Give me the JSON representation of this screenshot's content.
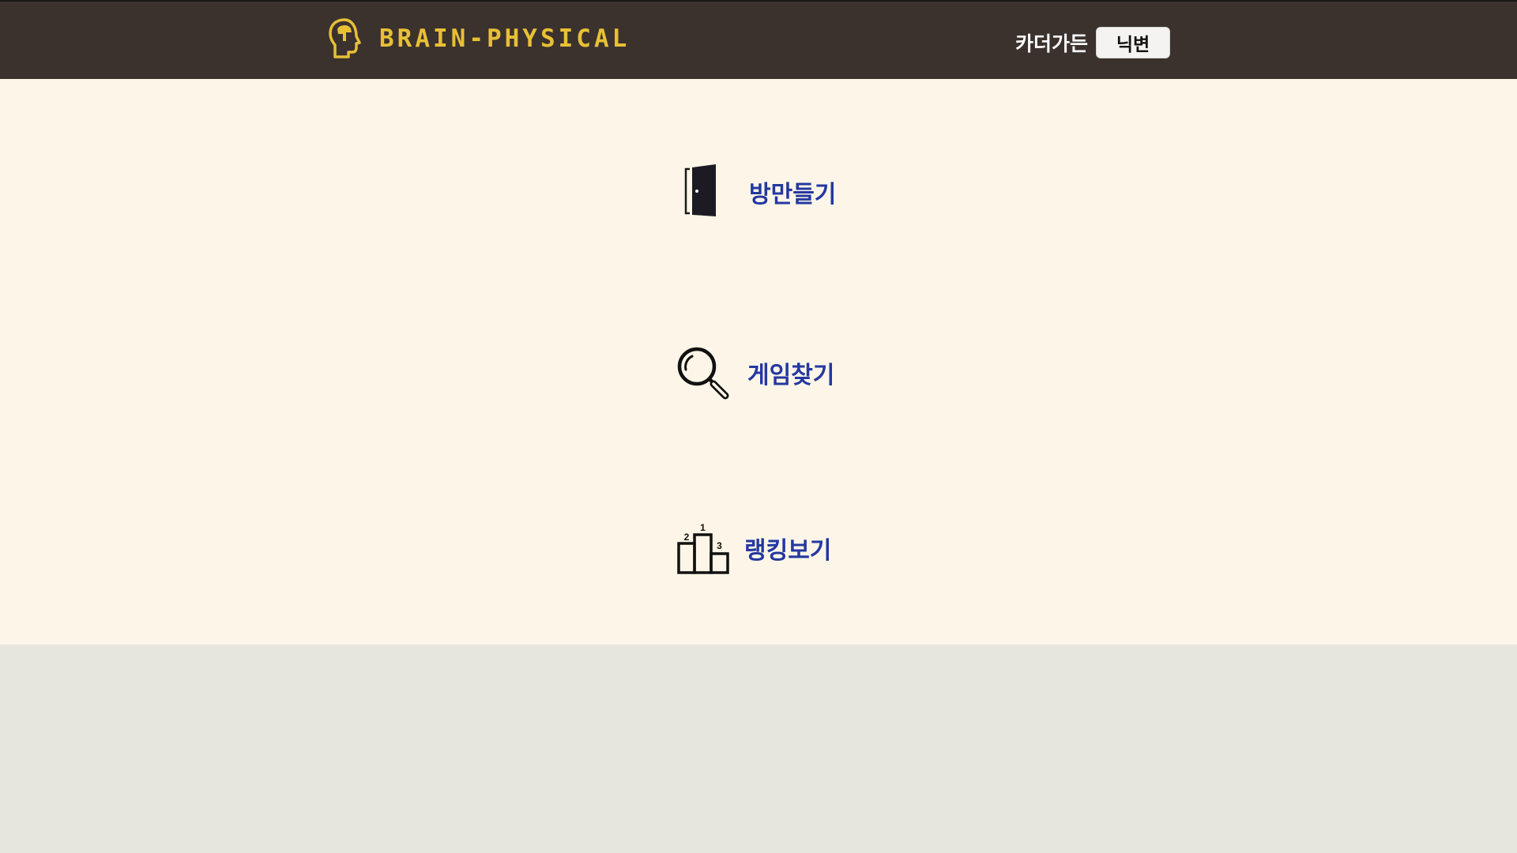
{
  "header": {
    "logo_text": "BRAIN-PHYSICAL",
    "logo_icon": "head-icon",
    "user_name": "카더가든",
    "nick_button_label": "닉변"
  },
  "menu": {
    "items": [
      {
        "label": "방만들기",
        "icon": "door-icon"
      },
      {
        "label": "게임찾기",
        "icon": "magnifier-icon"
      },
      {
        "label": "랭킹보기",
        "icon": "podium-icon"
      }
    ],
    "podium_ranks": [
      "1",
      "2",
      "3"
    ]
  },
  "colors": {
    "header_bg": "#3b322e",
    "logo_color": "#e7c035",
    "main_bg": "#fdf6e8",
    "footer_bg": "#e6e6df",
    "menu_label_color": "#2438a0"
  }
}
